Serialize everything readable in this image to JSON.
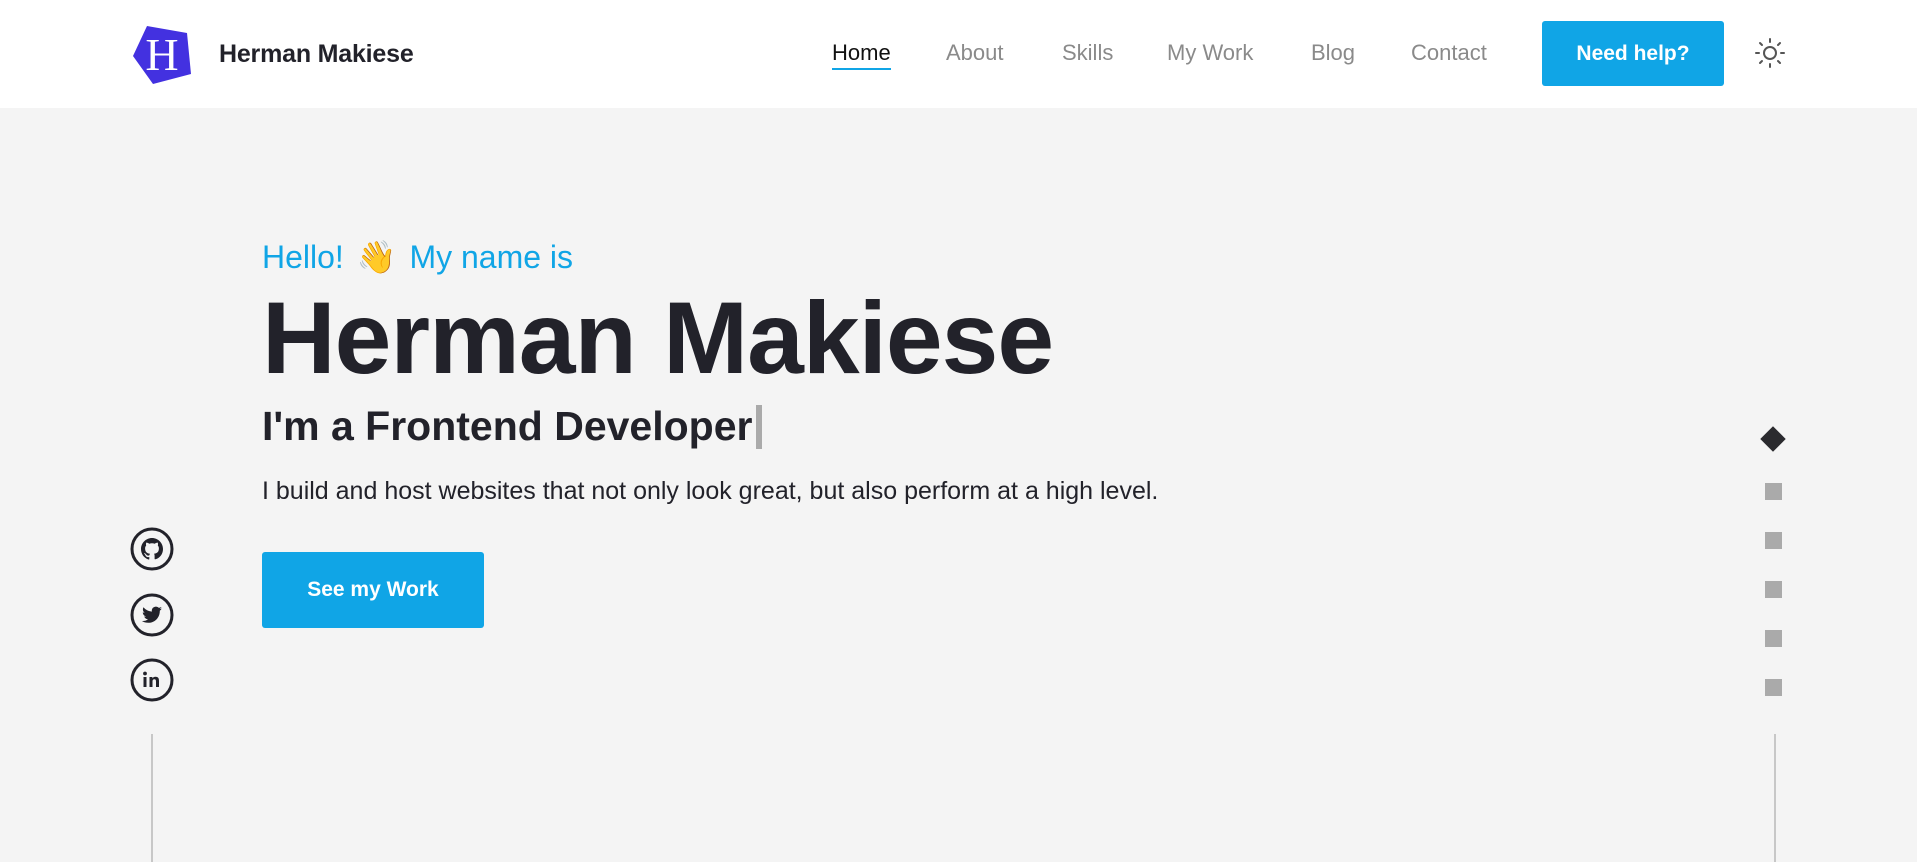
{
  "brand": {
    "logo_letter": "H",
    "name": "Herman Makiese",
    "logo_color": "#4331e0"
  },
  "nav": {
    "items": [
      {
        "label": "Home",
        "active": true
      },
      {
        "label": "About",
        "active": false
      },
      {
        "label": "Skills",
        "active": false
      },
      {
        "label": "My Work",
        "active": false
      },
      {
        "label": "Blog",
        "active": false
      },
      {
        "label": "Contact",
        "active": false
      }
    ],
    "help_button": "Need help?",
    "theme_toggle_icon": "sun-icon"
  },
  "hero": {
    "greeting_before": "Hello!",
    "greeting_emoji": "👋",
    "greeting_after": "My name is",
    "name": "Herman Makiese",
    "role": "I'm a Frontend Developer",
    "tagline": "I build and host websites that not only look great, but also perform at a high level.",
    "cta_label": "See my Work"
  },
  "social": [
    {
      "icon": "github-icon"
    },
    {
      "icon": "twitter-icon"
    },
    {
      "icon": "linkedin-icon"
    }
  ],
  "section_dots": {
    "count": 6,
    "active_index": 0
  },
  "colors": {
    "accent": "#10a5e6",
    "text": "#22222a",
    "background": "#f4f4f4"
  }
}
